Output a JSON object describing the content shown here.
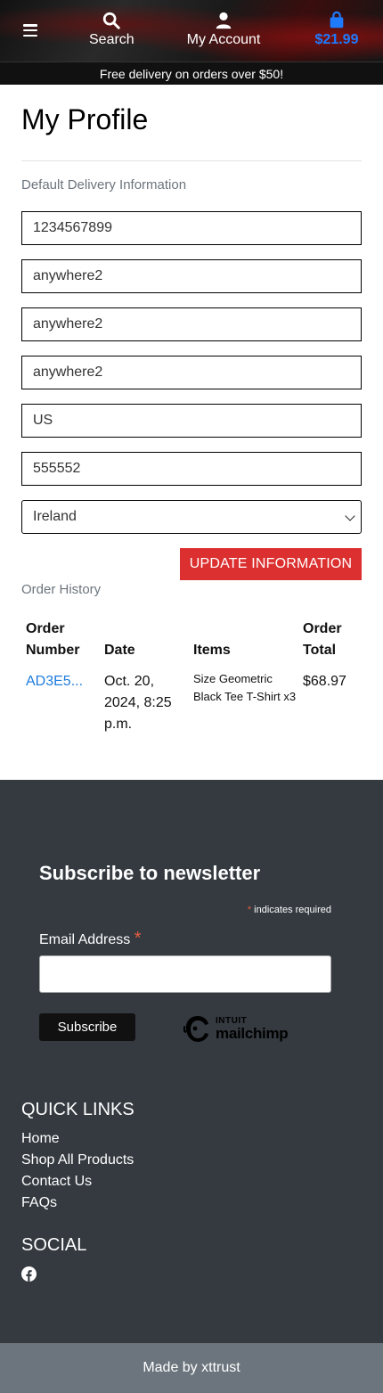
{
  "header": {
    "search_label": "Search",
    "account_label": "My Account",
    "bag_total": "$21.99",
    "promo": "Free delivery on orders over $50!",
    "bag_color": "#1e7bff"
  },
  "profile": {
    "title": "My Profile",
    "delivery_heading": "Default Delivery Information",
    "fields": {
      "phone": "1234567899",
      "address1": "anywhere2",
      "address2": "anywhere2",
      "town": "anywhere2",
      "county": "US",
      "postcode": "555552",
      "country": "Ireland"
    },
    "update_button": "UPDATE INFORMATION",
    "update_color": "#dc3030"
  },
  "orders": {
    "heading": "Order History",
    "columns": {
      "number_line1": "Order",
      "number_line2": "Number",
      "date": "Date",
      "items": "Items",
      "total_line1": "Order",
      "total_line2": "Total"
    },
    "rows": [
      {
        "number": "AD3E5...",
        "date_line1": "Oct. 20,",
        "date_line2": "2024, 8:25",
        "date_line3": "p.m.",
        "items_line1": "Size Geometric",
        "items_line2": "Black Tee T-Shirt x3",
        "total": "$68.97"
      }
    ]
  },
  "footer": {
    "newsletter_title": "Subscribe to newsletter",
    "required_note": "indicates required",
    "email_label": "Email Address",
    "subscribe_button": "Subscribe",
    "mailchimp_top": "INTUIT",
    "mailchimp_bottom": "mailchimp",
    "quick_links_title": "QUICK LINKS",
    "quick_links": [
      "Home",
      "Shop All Products",
      "Contact Us",
      "FAQs"
    ],
    "social_title": "SOCIAL",
    "social_icons": [
      "facebook-icon"
    ],
    "credit": "Made by xttrust"
  }
}
